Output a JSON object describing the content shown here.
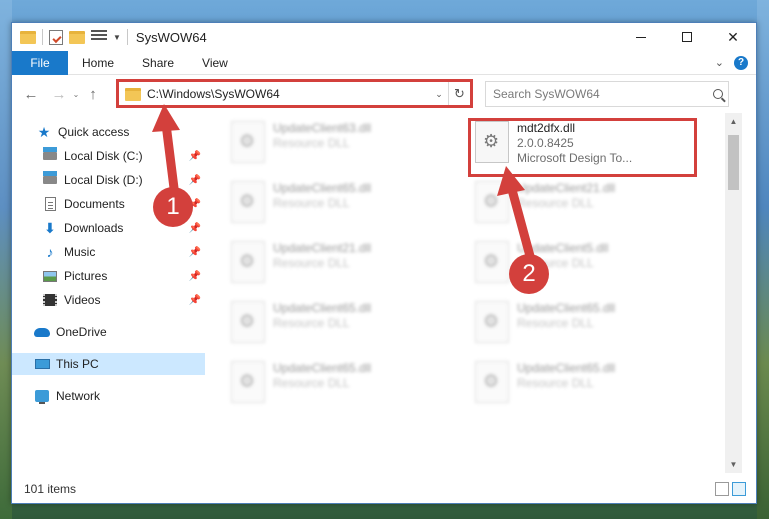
{
  "window": {
    "title": "SysWOW64",
    "controls": {
      "minimize": "—",
      "maximize": "□",
      "close": "✕"
    }
  },
  "ribbon": {
    "tabs": [
      "File",
      "Home",
      "Share",
      "View"
    ],
    "expand": "⌄",
    "help": "?"
  },
  "address_bar": {
    "path": "C:\\Windows\\SysWOW64",
    "dropdown": "⌄",
    "refresh": "↻"
  },
  "search": {
    "placeholder": "Search SysWOW64"
  },
  "nav_buttons": {
    "back": "←",
    "forward": "→",
    "recent": "⌄",
    "up": "↑"
  },
  "sidebar": {
    "items": [
      {
        "label": "Quick access",
        "icon": "star-icon"
      },
      {
        "label": "Local Disk (C:)",
        "icon": "disk-icon",
        "pinned": true
      },
      {
        "label": "Local Disk (D:)",
        "icon": "disk-icon",
        "pinned": true
      },
      {
        "label": "Documents",
        "icon": "documents-icon",
        "pinned": true
      },
      {
        "label": "Downloads",
        "icon": "downloads-icon",
        "pinned": true
      },
      {
        "label": "Music",
        "icon": "music-icon",
        "pinned": true
      },
      {
        "label": "Pictures",
        "icon": "pictures-icon",
        "pinned": true
      },
      {
        "label": "Videos",
        "icon": "videos-icon",
        "pinned": true
      },
      {
        "label": "OneDrive",
        "icon": "onedrive-icon"
      },
      {
        "label": "This PC",
        "icon": "this-pc-icon",
        "selected": true
      },
      {
        "label": "Network",
        "icon": "network-icon"
      }
    ]
  },
  "files": {
    "highlighted": {
      "name": "mdt2dfx.dll",
      "version": "2.0.0.8425",
      "description": "Microsoft Design To..."
    },
    "left_column": [
      {
        "name": "UpdateClient63.dll",
        "type": "Resource DLL"
      },
      {
        "name": "UpdateClient65.dll",
        "type": "Resource DLL"
      },
      {
        "name": "UpdateClient21.dll",
        "type": "Resource DLL"
      },
      {
        "name": "UpdateClient65.dll",
        "type": "Resource DLL"
      },
      {
        "name": "UpdateClient65.dll",
        "type": "Resource DLL"
      }
    ],
    "right_column": [
      {
        "name": "UpdateClient21.dll",
        "type": "Resource DLL"
      },
      {
        "name": "UpdateClient5.dll",
        "type": "Resource DLL"
      },
      {
        "name": "UpdateClient65.dll",
        "type": "Resource DLL"
      },
      {
        "name": "UpdateClient65.dll",
        "type": "Resource DLL"
      }
    ]
  },
  "status": {
    "item_count": "101 items"
  },
  "annotations": {
    "step1": "1",
    "step2": "2",
    "color": "#d3403c"
  }
}
